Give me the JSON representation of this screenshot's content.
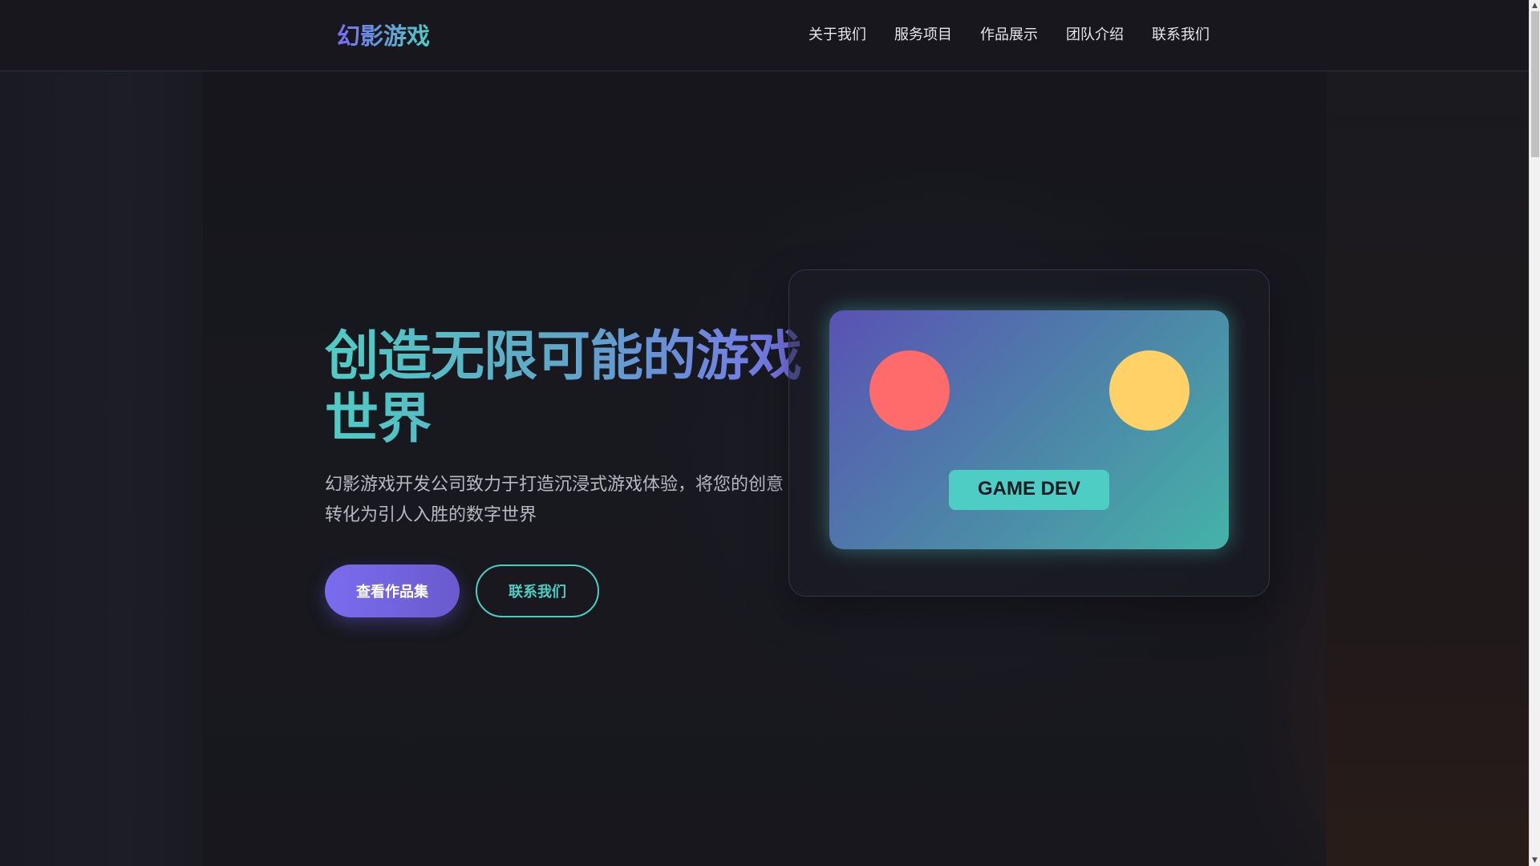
{
  "header": {
    "logo": "幻影游戏",
    "nav": [
      "关于我们",
      "服务项目",
      "作品展示",
      "团队介绍",
      "联系我们"
    ]
  },
  "hero": {
    "title": "创造无限可能的游戏世界",
    "description": "幻影游戏开发公司致力于打造沉浸式游戏体验，将您的创意转化为引人入胜的数字世界",
    "primary_button": "查看作品集",
    "secondary_button": "联系我们"
  },
  "card": {
    "label": "GAME DEV"
  },
  "colors": {
    "accent_purple": "#7b6cf0",
    "accent_teal": "#4ecdc4",
    "dot_red": "#ff6b6b",
    "dot_yellow": "#ffd166"
  }
}
